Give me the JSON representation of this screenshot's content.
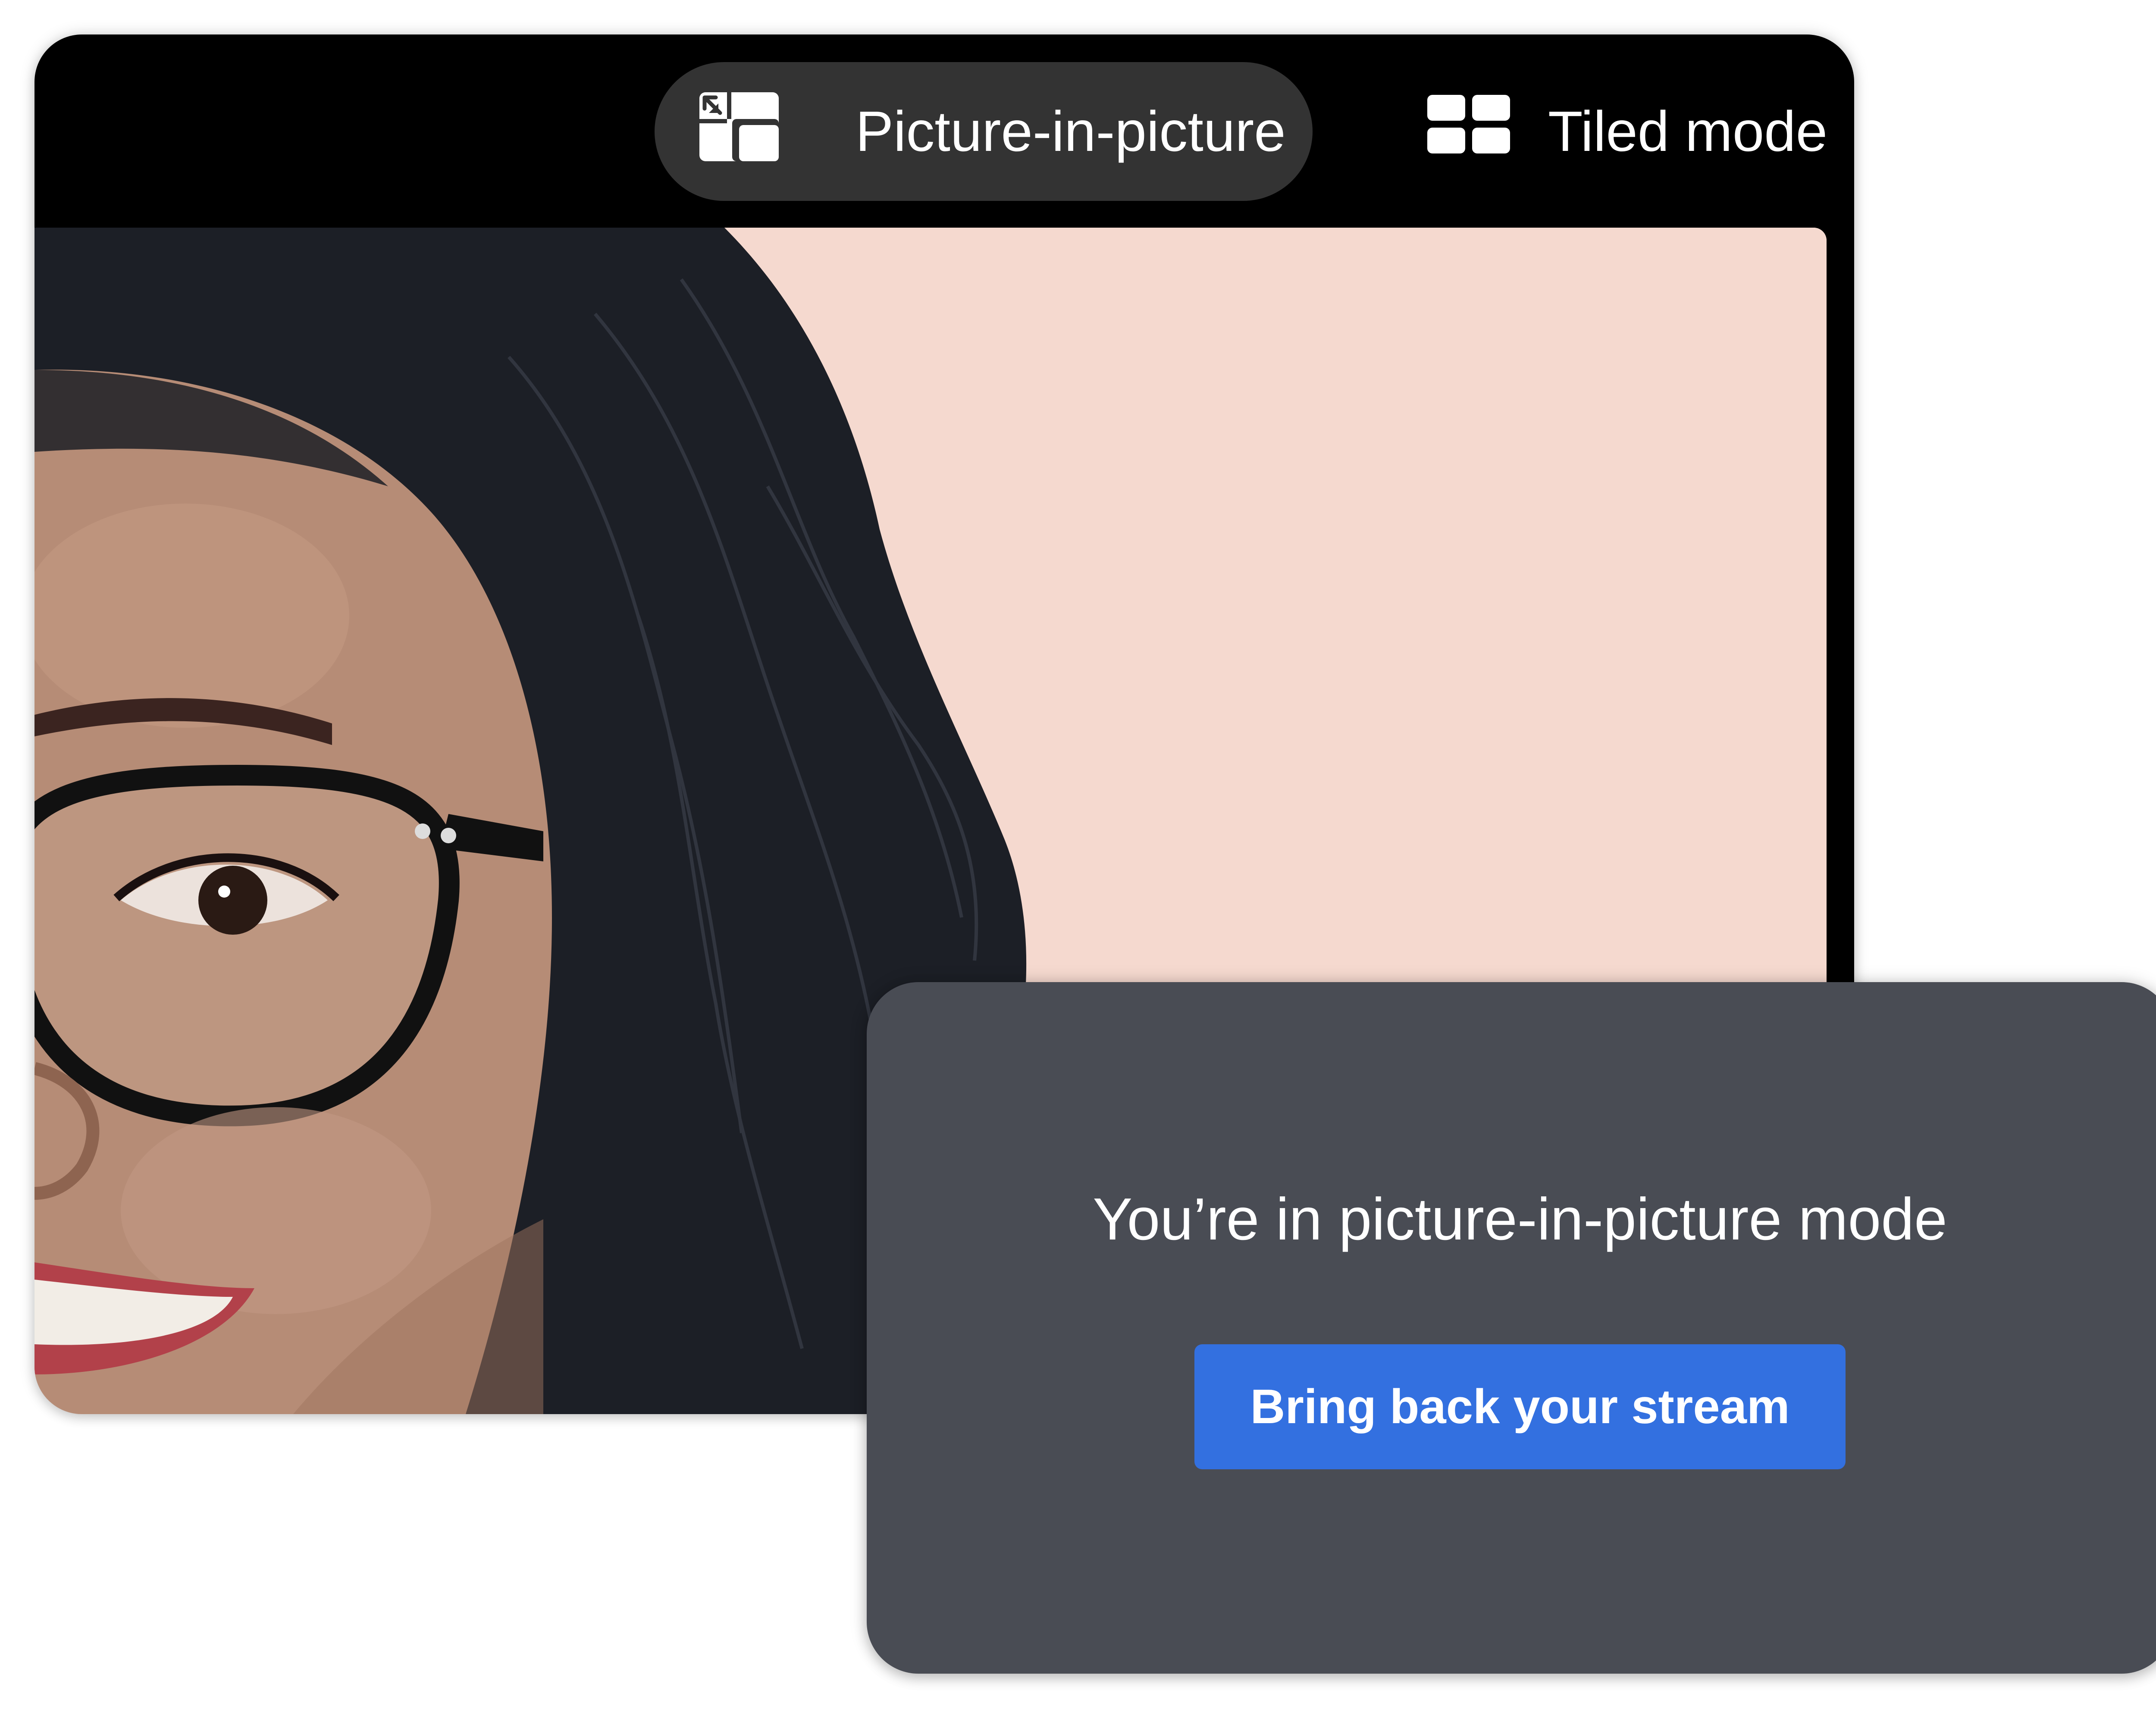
{
  "window": {
    "modes": {
      "pip": {
        "label": "Picture-in-picture",
        "icon": "picture-in-picture-icon",
        "active": true
      },
      "tiled": {
        "label": "Tiled mode",
        "icon": "tiled-grid-icon",
        "active": false
      }
    }
  },
  "video": {
    "background_color": "#f5d9cf"
  },
  "pip_panel": {
    "message": "You’re in picture-in-picture mode",
    "button_label": "Bring back your stream",
    "button_color": "#3370e0",
    "panel_color": "#494c54"
  }
}
